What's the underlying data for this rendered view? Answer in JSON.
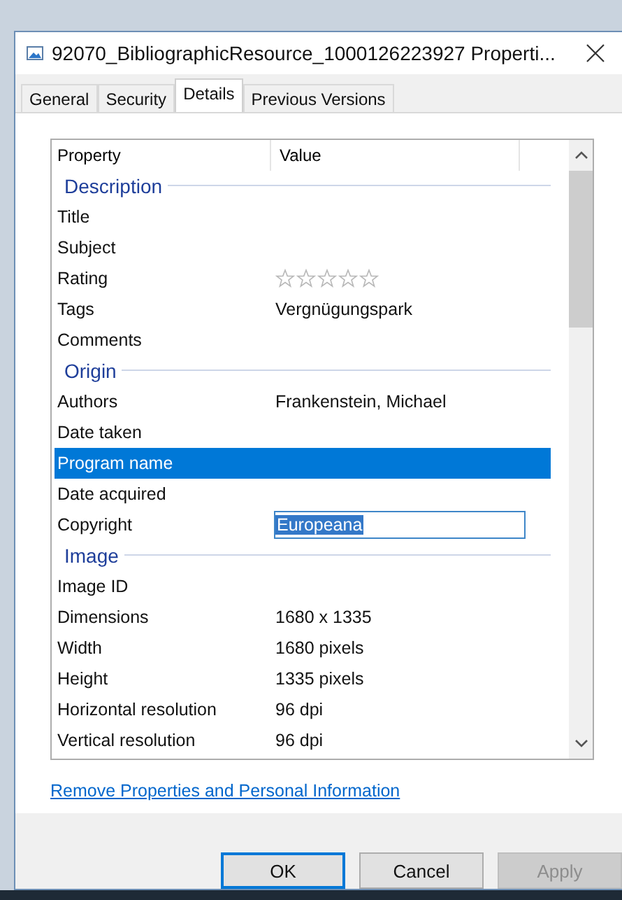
{
  "window": {
    "title": "92070_BibliographicResource_1000126223927 Properti..."
  },
  "tabs": [
    {
      "label": "General",
      "selected": false
    },
    {
      "label": "Security",
      "selected": false
    },
    {
      "label": "Details",
      "selected": true
    },
    {
      "label": "Previous Versions",
      "selected": false
    }
  ],
  "table": {
    "columns": [
      "Property",
      "Value"
    ],
    "groups": [
      {
        "heading": "Description",
        "rows": [
          {
            "kind": "text",
            "property": "Title",
            "selected": false
          },
          {
            "kind": "text",
            "property": "Subject",
            "selected": false
          },
          {
            "kind": "stars",
            "property": "Rating",
            "stars": 0,
            "selected": false
          },
          {
            "kind": "text",
            "property": "Tags",
            "value": "Vergnügungspark",
            "selected": false
          },
          {
            "kind": "text",
            "property": "Comments",
            "selected": false
          }
        ]
      },
      {
        "heading": "Origin",
        "rows": [
          {
            "kind": "text",
            "property": "Authors",
            "value": "Frankenstein, Michael",
            "selected": false
          },
          {
            "kind": "text",
            "property": "Date taken",
            "selected": false
          },
          {
            "kind": "text",
            "property": "Program name",
            "selected": true
          },
          {
            "kind": "text",
            "property": "Date acquired",
            "selected": false
          },
          {
            "kind": "edit",
            "property": "Copyright",
            "value": "Europeana",
            "selected": false
          }
        ]
      },
      {
        "heading": "Image",
        "rows": [
          {
            "kind": "text",
            "property": "Image ID",
            "selected": false
          },
          {
            "kind": "text",
            "property": "Dimensions",
            "value": "1680 x 1335",
            "selected": false
          },
          {
            "kind": "text",
            "property": "Width",
            "value": "1680 pixels",
            "selected": false
          },
          {
            "kind": "text",
            "property": "Height",
            "value": "1335 pixels",
            "selected": false
          },
          {
            "kind": "text",
            "property": "Horizontal resolution",
            "value": "96 dpi",
            "selected": false
          },
          {
            "kind": "text",
            "property": "Vertical resolution",
            "value": "96 dpi",
            "selected": false
          }
        ]
      }
    ]
  },
  "link": "Remove Properties and Personal Information",
  "buttons": [
    {
      "label": "OK",
      "disabled": false,
      "default": true
    },
    {
      "label": "Cancel",
      "disabled": false,
      "default": false
    },
    {
      "label": "Apply",
      "disabled": true,
      "default": false
    }
  ]
}
